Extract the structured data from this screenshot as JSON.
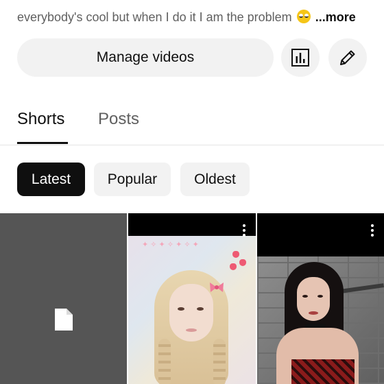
{
  "profile": {
    "bio_text": "everybody's cool but when I do it I am the problem",
    "bio_emoji": "rolling-eyes-emoji",
    "more_label": "...more"
  },
  "actions": {
    "manage_label": "Manage videos",
    "analytics_icon": "analytics-icon",
    "edit_icon": "pencil-icon"
  },
  "tabs": [
    {
      "label": "Shorts",
      "active": true
    },
    {
      "label": "Posts",
      "active": false
    }
  ],
  "filters": [
    {
      "label": "Latest",
      "selected": true
    },
    {
      "label": "Popular",
      "selected": false
    },
    {
      "label": "Oldest",
      "selected": false
    }
  ],
  "shorts": [
    {
      "kind": "placeholder",
      "icon": "document-icon"
    },
    {
      "kind": "thumbnail",
      "menu_icon": "more-vert-icon"
    },
    {
      "kind": "thumbnail",
      "menu_icon": "more-vert-icon"
    }
  ],
  "colors": {
    "text_primary": "#0f0f0f",
    "text_secondary": "#606060",
    "chip_bg": "#f2f2f2",
    "chip_active_bg": "#0f0f0f",
    "placeholder_tile": "#555555"
  }
}
